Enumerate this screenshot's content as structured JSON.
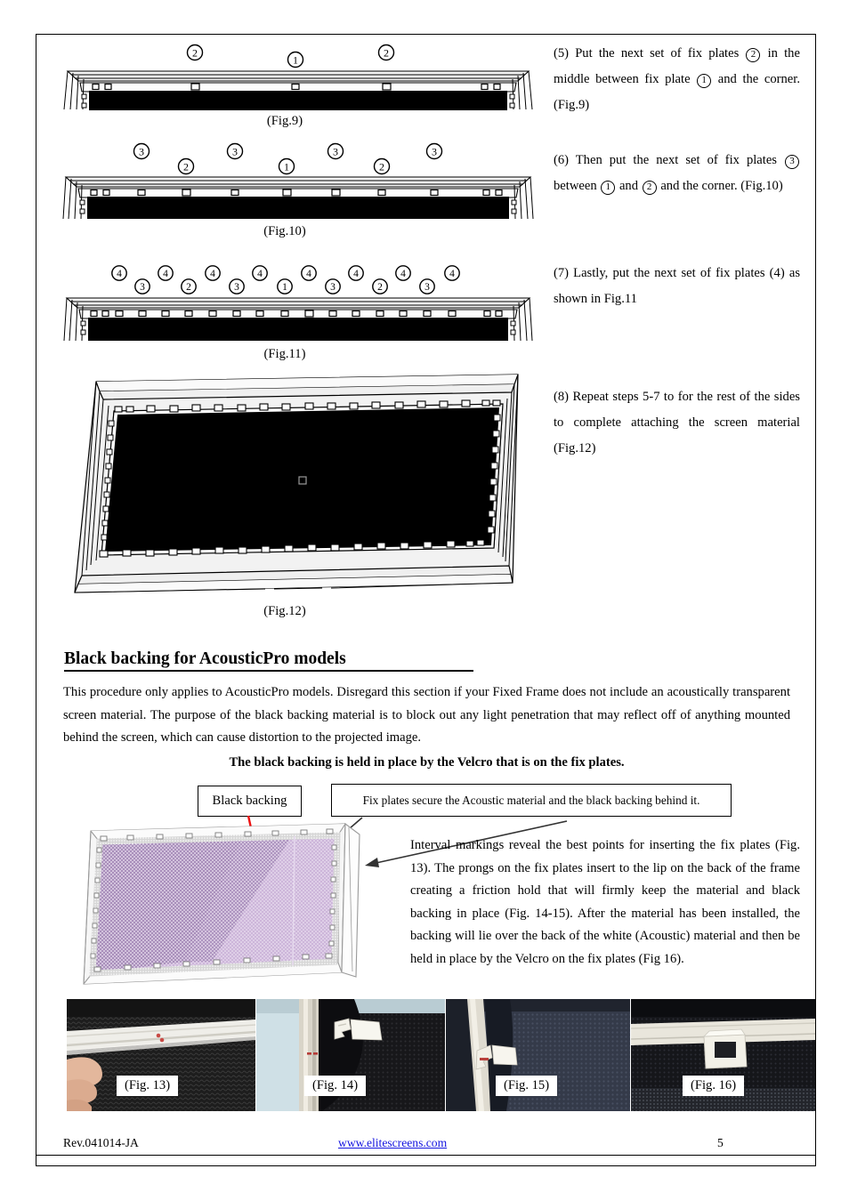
{
  "document": {
    "page_number": "5",
    "revision": "Rev.041014-JA",
    "website": "www.elitescreens.com",
    "link_color": "#1515e0"
  },
  "instructions": [
    {
      "id": "step5",
      "text_parts": [
        "(5) Put the next set of fix plates ",
        "2",
        " in the middle between fix plate ",
        "1",
        " and the corner. (Fig.9)"
      ],
      "plain": "(5) Put the next set of fix plates 2 in the middle between fix plate 1 and the corner. (Fig.9)"
    },
    {
      "id": "step6",
      "plain": "(6) Then put the next set of fix plates 3 between 1 and 2 and the corner. (Fig.10)"
    },
    {
      "id": "step7",
      "plain": "(7) Lastly, put the next set of fix plates (4) as shown in Fig.11"
    },
    {
      "id": "step8",
      "plain": "(8) Repeat steps 5-7 to for the rest of the sides to complete attaching the screen material (Fig.12)"
    }
  ],
  "step_text": {
    "s5_a": "(5) Put the next set of fix plates",
    "s5_n1": "2",
    "s5_b": "in the middle between fix plate",
    "s5_n2": "1",
    "s5_c": "and the corner. (Fig.9)",
    "s6_a": "(6) Then put the next set of fix plates",
    "s6_n1": "3",
    "s6_b": "between",
    "s6_n2": "1",
    "s6_c": "and",
    "s6_n3": "2",
    "s6_d": "and the corner. (Fig.10)",
    "s7": "(7) Lastly, put the next set of fix plates (4) as shown in Fig.11",
    "s8": "(8) Repeat steps 5-7 to for the rest of the sides to complete attaching the screen material (Fig.12)"
  },
  "figure_captions": {
    "fig9": "(Fig.9)",
    "fig10": "(Fig.10)",
    "fig11": "(Fig.11)",
    "fig12": "(Fig.12)",
    "fig13": "(Fig. 13)",
    "fig14": "(Fig. 14)",
    "fig15": "(Fig. 15)",
    "fig16": "(Fig. 16)"
  },
  "figure_labels": {
    "fig9_row1": [
      "2",
      "1",
      "2"
    ],
    "fig10_row_upper": [
      "3",
      "3",
      "3",
      "3"
    ],
    "fig10_row_lower": [
      "2",
      "1",
      "2"
    ],
    "fig11_row_upper": [
      "4",
      "4",
      "4",
      "4",
      "4",
      "4",
      "4",
      "4"
    ],
    "fig11_row_lower": [
      "3",
      "2",
      "3",
      "1",
      "3",
      "2",
      "3"
    ]
  },
  "section": {
    "heading": "Black backing for AcousticPro models",
    "body": "This procedure only applies to AcousticPro models. Disregard this section if your Fixed Frame does not include an acoustically transparent screen material. The purpose of the black backing material is to block out any light penetration that may reflect off of anything mounted behind the screen, which can cause distortion to the projected image.",
    "bold_note": "The black backing is held in place by the Velcro that is on the fix plates.",
    "interval_text": "Interval markings reveal the best points for inserting the fix plates (Fig. 13). The prongs on the fix plates insert to the lip on the back of the frame creating a friction hold that will firmly keep the material and black backing in place (Fig. 14-15). After the material has been installed, the backing will lie over the back of the white (Acoustic) material and then be held in place by the Velcro on the fix plates (Fig 16)."
  },
  "callouts": {
    "black_backing": "Black backing",
    "fix_plates": "Fix plates secure the Acoustic material and the black backing behind it.",
    "black_backing_arrow_color": "#ee1111",
    "fix_plates_arrow_color": "#333333"
  },
  "colors": {
    "screen_black": "#000000",
    "mesh_purple": "#a98fbb",
    "mesh_light_purple": "#cdb6da",
    "frame_gray": "#d8d8d8",
    "photo_bg_dark": "#1b1b1b",
    "photo_rail": "#e8e6e0",
    "photo_blue": "#cfe0e6"
  }
}
